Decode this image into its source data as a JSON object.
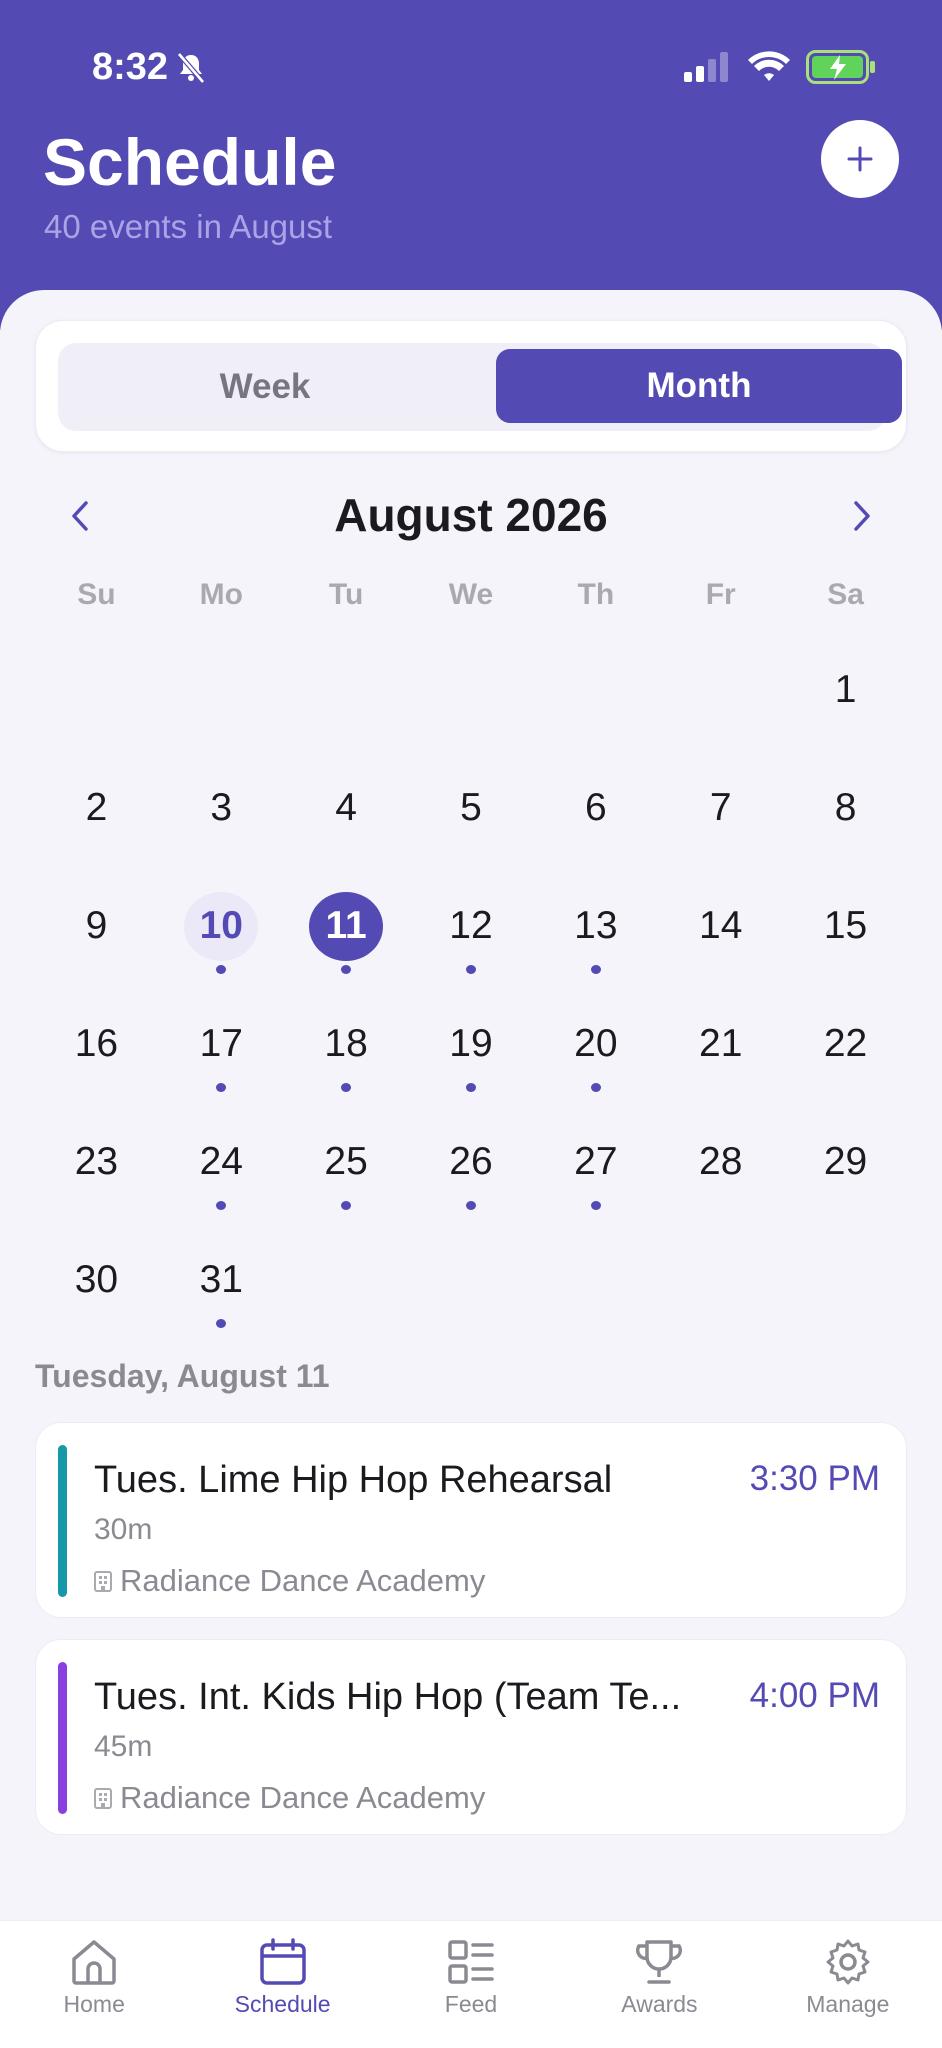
{
  "status": {
    "time": "8:32"
  },
  "header": {
    "title": "Schedule",
    "subtitle": "40 events in August"
  },
  "segment": {
    "week_label": "Week",
    "month_label": "Month",
    "selected": "Month"
  },
  "calendar": {
    "month_label": "August 2026",
    "weekdays": [
      "Su",
      "Mo",
      "Tu",
      "We",
      "Th",
      "Fr",
      "Sa"
    ],
    "leading_blanks": 6,
    "days_in_month": 31,
    "today": 10,
    "selected": 11,
    "event_days": [
      10,
      11,
      12,
      13,
      17,
      18,
      19,
      20,
      24,
      25,
      26,
      27,
      31
    ]
  },
  "day_list": {
    "heading": "Tuesday, August 11",
    "events": [
      {
        "name": "Tues. Lime Hip Hop Rehearsal",
        "duration": "30m",
        "location": "Radiance Dance Academy",
        "time": "3:30 PM",
        "color": "#1798a8"
      },
      {
        "name": "Tues. Int. Kids Hip Hop (Team Te...",
        "duration": "45m",
        "location": "Radiance Dance Academy",
        "time": "4:00 PM",
        "color": "#8a3fe0"
      }
    ]
  },
  "tabbar": {
    "items": [
      {
        "label": "Home",
        "icon": "home-icon"
      },
      {
        "label": "Schedule",
        "icon": "calendar-icon",
        "active": true
      },
      {
        "label": "Feed",
        "icon": "feed-icon"
      },
      {
        "label": "Awards",
        "icon": "trophy-icon"
      },
      {
        "label": "Manage",
        "icon": "gear-icon"
      }
    ]
  },
  "colors": {
    "accent": "#534bb3",
    "background": "#f5f4fb"
  }
}
